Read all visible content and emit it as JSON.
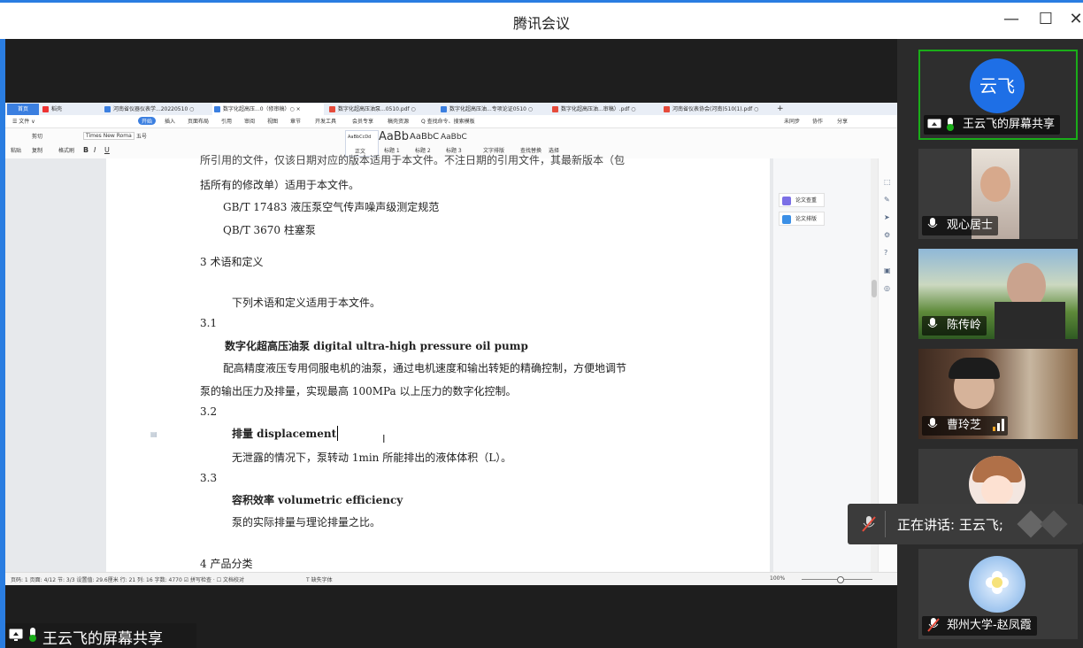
{
  "window": {
    "title": "腾讯会议",
    "minimize": "—",
    "maximize": "☐",
    "close": "✕"
  },
  "wps": {
    "tabs": [
      "首页",
      "稻壳",
      "河南省仪器仪表学...20220510 ○",
      "数字化超高压...0（修审稿）○ ×",
      "数字化超高压油泵...0510.pdf ○",
      "数字化超高压油...专项论证0510 ○",
      "数字化超高压油...审稿）.pdf ○",
      "河南省仪表协会(河南)510(1).pdf ○"
    ],
    "menu": [
      "☰ 文件 ∨",
      "开始",
      "插入",
      "页面布局",
      "引用",
      "审阅",
      "视图",
      "章节",
      "开发工具",
      "会员专享",
      "稿壳资源",
      "Q 查找命令、搜索模板"
    ],
    "menu_right": [
      "未同步",
      "协作",
      "分享"
    ],
    "ribbon": {
      "font_name": "Times New Roma",
      "font_size": "五号",
      "style_normal": "正文",
      "style_h1": "标题 1",
      "style_h2": "标题 2",
      "style_h3": "标题 3",
      "style_sample_normal": "AaBbCcDd",
      "style_sample_h1": "AaBb",
      "style_sample_h2": "AaBbC",
      "style_sample_h3": "AaBbC",
      "text_layout": "文字排版",
      "find_replace": "查找替换",
      "select": "选择",
      "paste": "粘贴",
      "cut": "剪切",
      "copy": "复制",
      "format_painter": "格式刷"
    },
    "right_panel": {
      "btn1": "论文查重",
      "btn2": "论文排版"
    },
    "document": {
      "line_top": "所引用的文件，仅该日期对应的版本适用于本文件。不注日期的引用文件，其最新版本（包",
      "line1": "括所有的修改单）适用于本文件。",
      "ref1": "GB/T 17483  液压泵空气传声噪声级测定规范",
      "ref2": "QB/T 3670 柱塞泵",
      "sec3": "3   术语和定义",
      "intro": "下列术语和定义适用于本文件。",
      "n31": "3.1",
      "term31": "数字化超高压油泵 digital ultra-high pressure oil pump",
      "def31a": "配高精度液压专用伺服电机的油泵，通过电机速度和输出转矩的精确控制，方便地调节",
      "def31b": "泵的输出压力及排量，实现最高 100MPa 以上压力的数字化控制。",
      "n32": "3.2",
      "term32": "排量 displacement",
      "def32": "无泄露的情况下，泵转动 1min 所能排出的液体体积（L）。",
      "n33": "3.3",
      "term33": "容积效率 volumetric efficiency",
      "def33": "泵的实际排量与理论排量之比。",
      "sec4": "4   产品分类"
    },
    "status": {
      "left": "页码: 1  页面: 4/12  节: 3/3  设置值: 29.6厘米  行: 21  列: 16  字数: 4770  ☑ 拼写检查 ·  ☐ 文档校对  ",
      "font_missing": "T 缺失字体",
      "zoom": "100%"
    }
  },
  "share_label": "王云飞的屏幕共享",
  "participants": [
    {
      "name": "王云飞的屏幕共享",
      "avatar_text": "云飞",
      "accent": "#1aad19"
    },
    {
      "name": "观心居士"
    },
    {
      "name": "陈传岭"
    },
    {
      "name": "曹玲芝"
    },
    {
      "name": ""
    },
    {
      "name": "郑州大学-赵凤霞",
      "muted": true
    }
  ],
  "speaking": "正在讲话: 王云飞;",
  "colors": {
    "accent": "#2a7de1",
    "green": "#1aad19",
    "dark": "#2b2b2b"
  }
}
